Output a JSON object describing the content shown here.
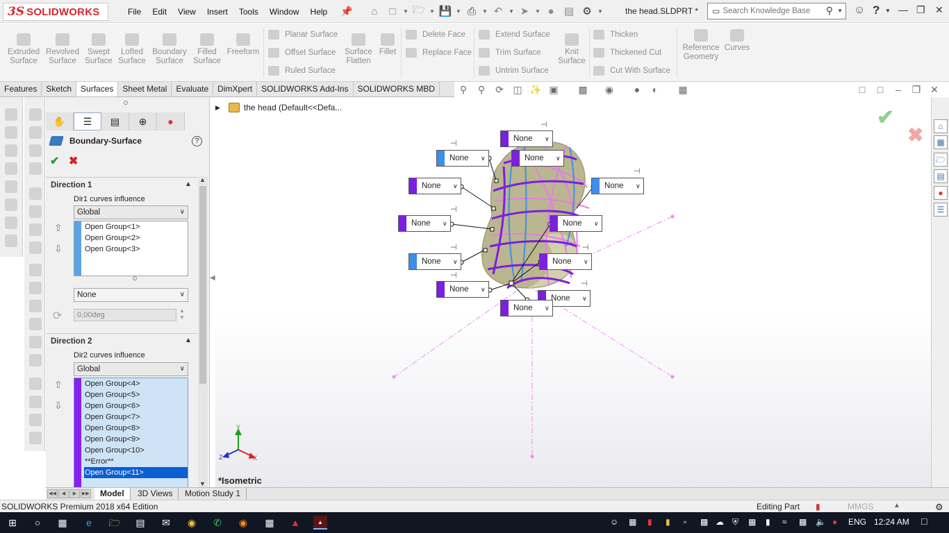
{
  "app": {
    "logo_ds": "3S",
    "logo_text": "SOLIDWORKS",
    "doc_title": "the head.SLDPRT *"
  },
  "menu": [
    "File",
    "Edit",
    "View",
    "Insert",
    "Tools",
    "Window",
    "Help"
  ],
  "search": {
    "placeholder": "Search Knowledge Base"
  },
  "ribbon": {
    "big": [
      {
        "label1": "Extruded",
        "label2": "Surface"
      },
      {
        "label1": "Revolved",
        "label2": "Surface"
      },
      {
        "label1": "Swept",
        "label2": "Surface"
      },
      {
        "label1": "Lofted",
        "label2": "Surface"
      },
      {
        "label1": "Boundary",
        "label2": "Surface"
      },
      {
        "label1": "Filled",
        "label2": "Surface"
      },
      {
        "label1": "Freeform",
        "label2": ""
      }
    ],
    "col1": [
      "Planar Surface",
      "Offset Surface",
      "Ruled Surface"
    ],
    "surface_flatten": {
      "label1": "Surface",
      "label2": "Flatten"
    },
    "fillet": "Fillet",
    "col2": [
      "Delete Face",
      "Replace Face"
    ],
    "col3": [
      "Extend Surface",
      "Trim Surface",
      "Untrim Surface"
    ],
    "knit": {
      "label1": "Knit",
      "label2": "Surface"
    },
    "col4": [
      "Thicken",
      "Thickened Cut",
      "Cut With Surface"
    ],
    "refgeom": {
      "label1": "Reference",
      "label2": "Geometry"
    },
    "curves": "Curves"
  },
  "tabs": [
    "Features",
    "Sketch",
    "Surfaces",
    "Sheet Metal",
    "Evaluate",
    "DimXpert",
    "SOLIDWORKS Add-Ins",
    "SOLIDWORKS MBD"
  ],
  "active_tab": "Surfaces",
  "property_manager": {
    "title": "Boundary-Surface",
    "direction1": {
      "header": "Direction 1",
      "influence_label": "Dir1 curves influence",
      "influence_value": "Global",
      "items": [
        "Open Group<1>",
        "Open Group<2>",
        "Open Group<3>"
      ],
      "tangency": "None",
      "angle": "0.00deg"
    },
    "direction2": {
      "header": "Direction 2",
      "influence_label": "Dir2 curves influence",
      "influence_value": "Global",
      "items": [
        "Open Group<4>",
        "Open Group<5>",
        "Open Group<6>",
        "Open Group<7>",
        "Open Group<8>",
        "Open Group<9>",
        "Open Group<10>",
        "**Error**",
        "Open Group<11>"
      ],
      "selected_item": "Open Group<11>"
    }
  },
  "graphics": {
    "tree_root": "the head  (Default<<Defa...",
    "view_name": "*Isometric",
    "triad": {
      "x": "X",
      "y": "Y",
      "z": "Z"
    },
    "callout_value": "None",
    "colors": {
      "purple": "#7b1fe0",
      "blue": "#3d8fe8",
      "pink": "#e87be8",
      "skin": "#b7b48c"
    }
  },
  "bottom_tabs": [
    "Model",
    "3D Views",
    "Motion Study 1"
  ],
  "active_bottom_tab": "Model",
  "status": {
    "left": "SOLIDWORKS Premium 2018 x64 Edition",
    "mode": "Editing Part",
    "units": "MMGS"
  },
  "taskbar": {
    "lang": "ENG",
    "time": "12:24 AM"
  }
}
